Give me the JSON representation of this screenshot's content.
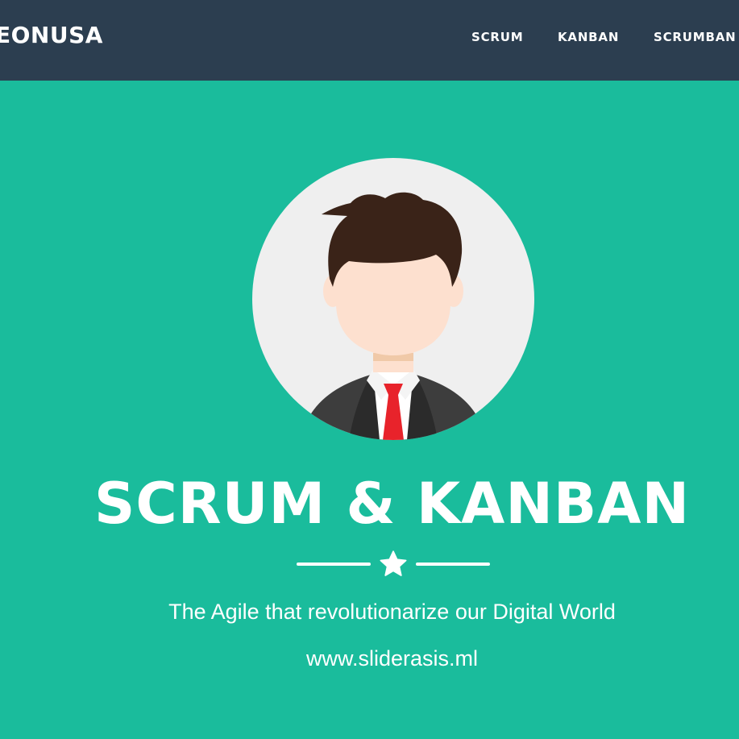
{
  "navbar": {
    "brand": "EONUSA",
    "links": [
      {
        "label": "SCRUM"
      },
      {
        "label": "KANBAN"
      },
      {
        "label": "SCRUMBAN"
      }
    ]
  },
  "hero": {
    "avatar_icon": "user-avatar-icon",
    "title": "SCRUM & KANBAN",
    "divider_icon": "star-icon",
    "subtitle": "The Agile that revolutionarize our Digital World",
    "url": "www.sliderasis.ml"
  },
  "colors": {
    "navbar_bg": "#2c3e50",
    "hero_bg": "#1abc9c",
    "avatar_bg": "#efefef",
    "hair": "#3a2318",
    "skin": "#fde0cf",
    "suit": "#3d3d3d",
    "tie": "#e8232b",
    "text": "#ffffff"
  }
}
